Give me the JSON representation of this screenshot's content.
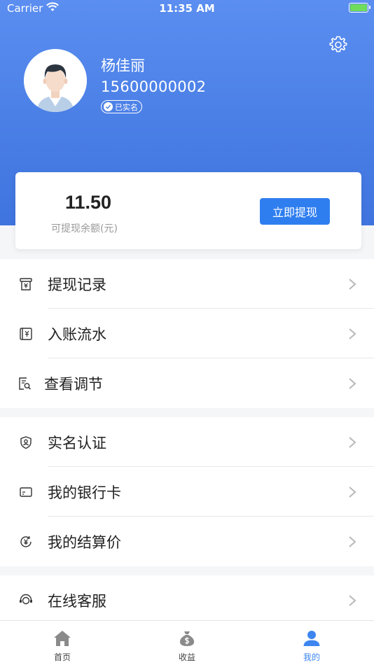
{
  "status_bar": {
    "carrier": "Carrier",
    "time": "11:35 AM"
  },
  "profile": {
    "name": "杨佳丽",
    "phone": "15600000002",
    "verified_label": "已实名"
  },
  "balance": {
    "amount": "11.50",
    "label": "可提现余额(元)",
    "withdraw_button": "立即提现"
  },
  "menu_groups": [
    [
      {
        "label": "提现记录",
        "icon": "receipt-icon"
      },
      {
        "label": "入账流水",
        "icon": "ledger-icon"
      },
      {
        "label": "查看调节",
        "icon": "document-search-icon"
      }
    ],
    [
      {
        "label": "实名认证",
        "icon": "id-shield-icon"
      },
      {
        "label": "我的银行卡",
        "icon": "bank-card-icon"
      },
      {
        "label": "我的结算价",
        "icon": "yen-refresh-icon"
      }
    ],
    [
      {
        "label": "在线客服",
        "icon": "headset-icon"
      }
    ]
  ],
  "tab_bar": [
    {
      "label": "首页",
      "icon": "home-icon",
      "active": false
    },
    {
      "label": "收益",
      "icon": "money-bag-icon",
      "active": false
    },
    {
      "label": "我的",
      "icon": "person-icon",
      "active": true
    }
  ],
  "colors": {
    "header_gradient_top": "#5b8ef0",
    "header_gradient_bottom": "#3f74df",
    "accent": "#2f7ef0",
    "tab_active": "#3d86f0"
  }
}
